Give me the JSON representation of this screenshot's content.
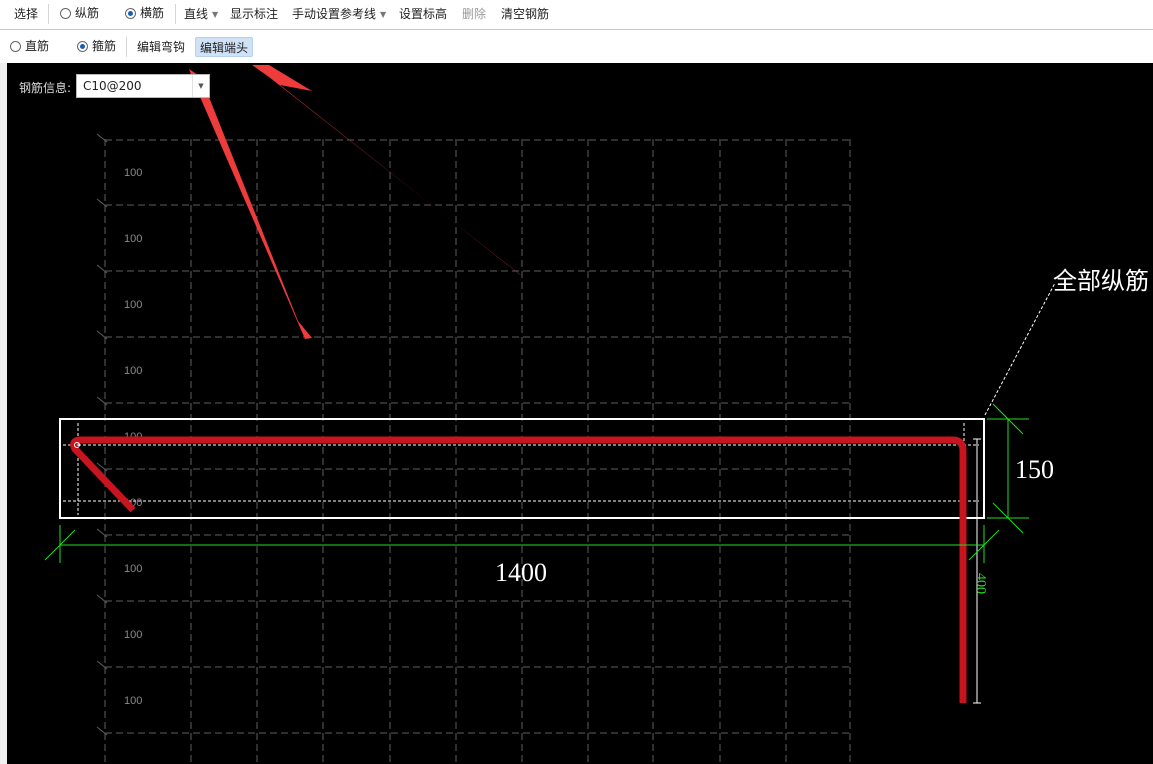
{
  "toolbar1": {
    "select": "选择",
    "longitudinal": "纵筋",
    "transverse": "横筋",
    "line": "直线",
    "show_dims": "显示标注",
    "manual_ref": "手动设置参考线",
    "set_elevation": "设置标高",
    "delete": "删除",
    "clear": "清空钢筋",
    "selected_mode": "横筋"
  },
  "toolbar2": {
    "straight": "直筋",
    "stirrup": "箍筋",
    "edit_hook": "编辑弯钩",
    "edit_end": "编辑端头",
    "selected_mode": "箍筋"
  },
  "rebar_info": {
    "label": "钢筋信息:",
    "value": "C10@200"
  },
  "grid": {
    "row_labels": [
      "100",
      "100",
      "100",
      "100",
      "100",
      "100",
      "100",
      "100",
      "100",
      "100"
    ]
  },
  "dimensions": {
    "width": "1400",
    "height": "150",
    "leg": "400"
  },
  "annotation": {
    "text": "全部纵筋"
  },
  "colors": {
    "canvas_bg": "#000000",
    "rebar": "#c8141e",
    "dimension": "#22dd22",
    "arrow": "#ee3b3b",
    "grid": "#6e6e6e",
    "outline": "#ffffff"
  }
}
